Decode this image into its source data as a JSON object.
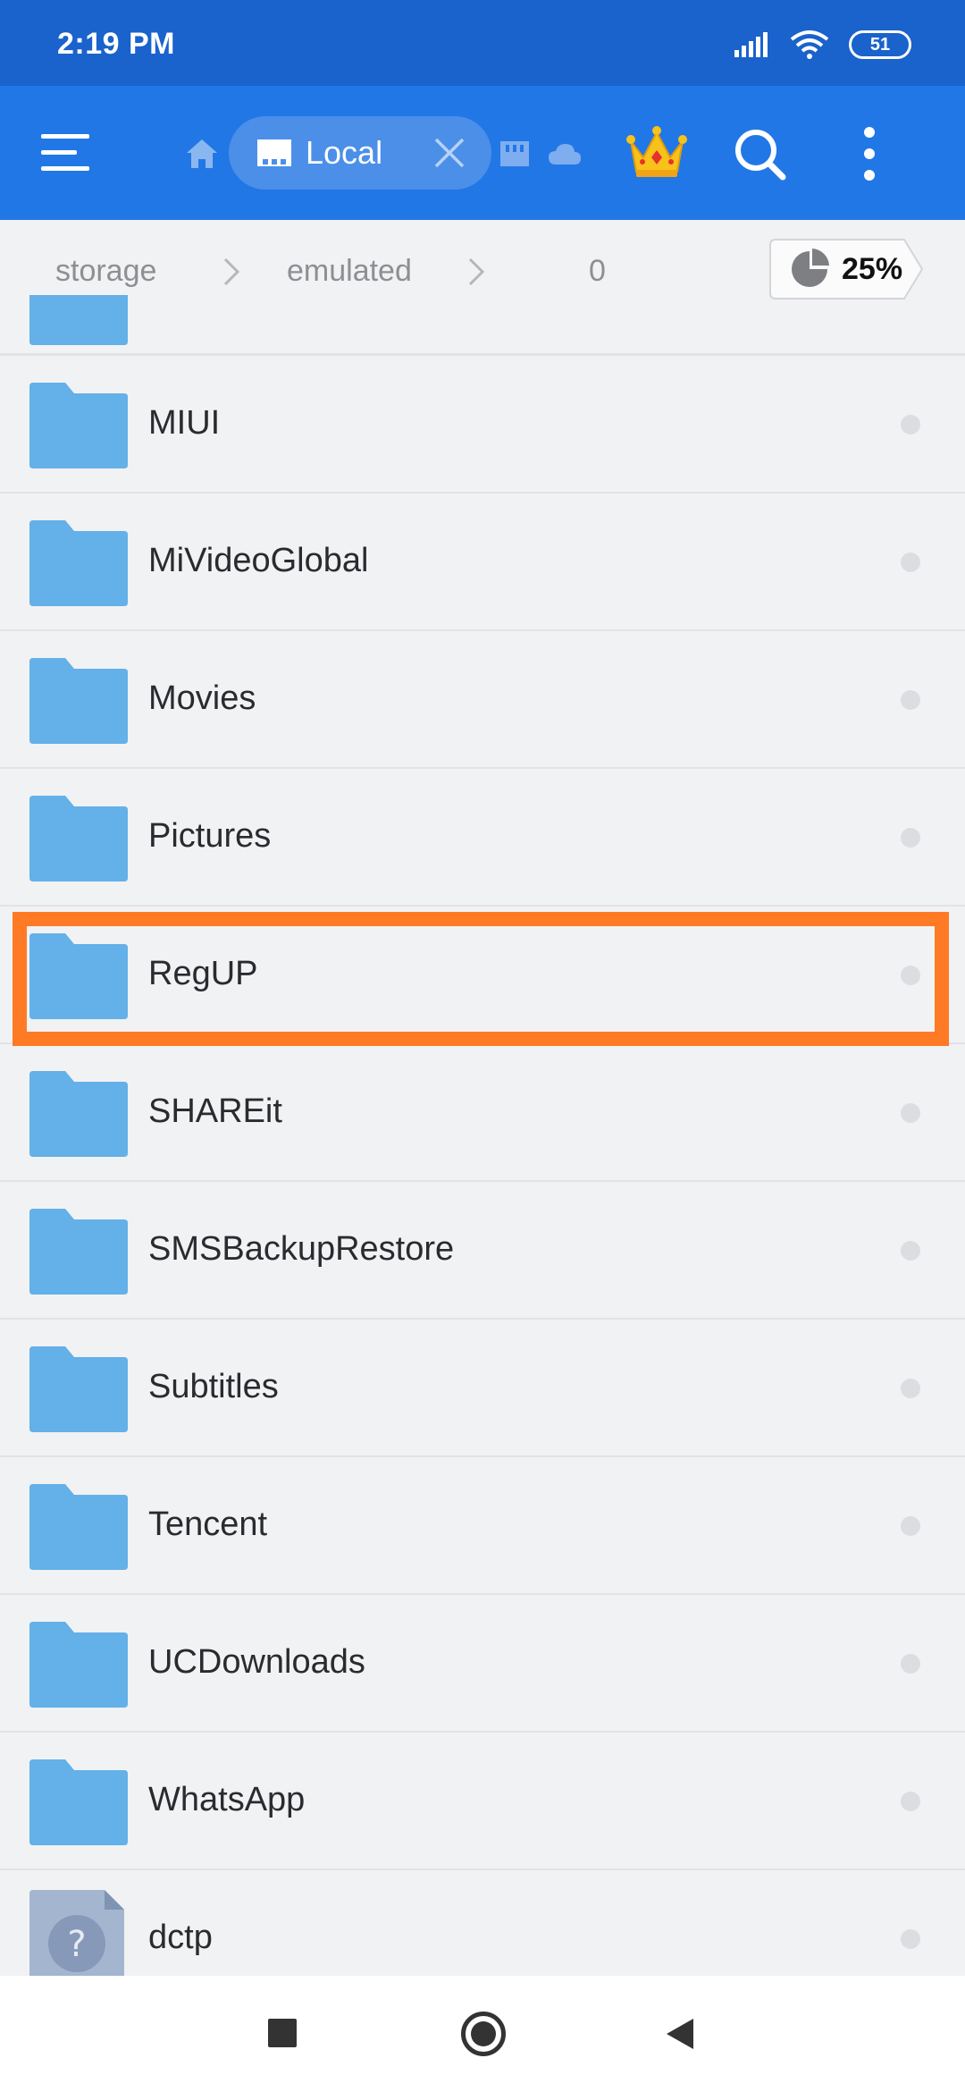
{
  "status_bar": {
    "time": "2:19 PM",
    "battery": "51"
  },
  "toolbar": {
    "tab_label": "Local",
    "icons": [
      "menu-icon",
      "home-icon",
      "sd-card-icon",
      "close-icon",
      "sd-icon",
      "cloud-icon",
      "crown-icon",
      "search-icon",
      "more-vert-icon"
    ]
  },
  "breadcrumb": {
    "items": [
      "storage",
      "emulated",
      "0"
    ],
    "storage_usage": "25%"
  },
  "files": [
    {
      "name": "MIUI",
      "type": "folder"
    },
    {
      "name": "MiVideoGlobal",
      "type": "folder"
    },
    {
      "name": "Movies",
      "type": "folder"
    },
    {
      "name": "Pictures",
      "type": "folder"
    },
    {
      "name": "RegUP",
      "type": "folder"
    },
    {
      "name": "SHAREit",
      "type": "folder"
    },
    {
      "name": "SMSBackupRestore",
      "type": "folder"
    },
    {
      "name": "Subtitles",
      "type": "folder"
    },
    {
      "name": "Tencent",
      "type": "folder"
    },
    {
      "name": "UCDownloads",
      "type": "folder"
    },
    {
      "name": "WhatsApp",
      "type": "folder"
    },
    {
      "name": "dctp",
      "type": "unknown"
    }
  ],
  "colors": {
    "status_bar": "#1a62cc",
    "toolbar": "#2277e6",
    "folder": "#64b0e8",
    "highlight": "#ff7a24"
  }
}
